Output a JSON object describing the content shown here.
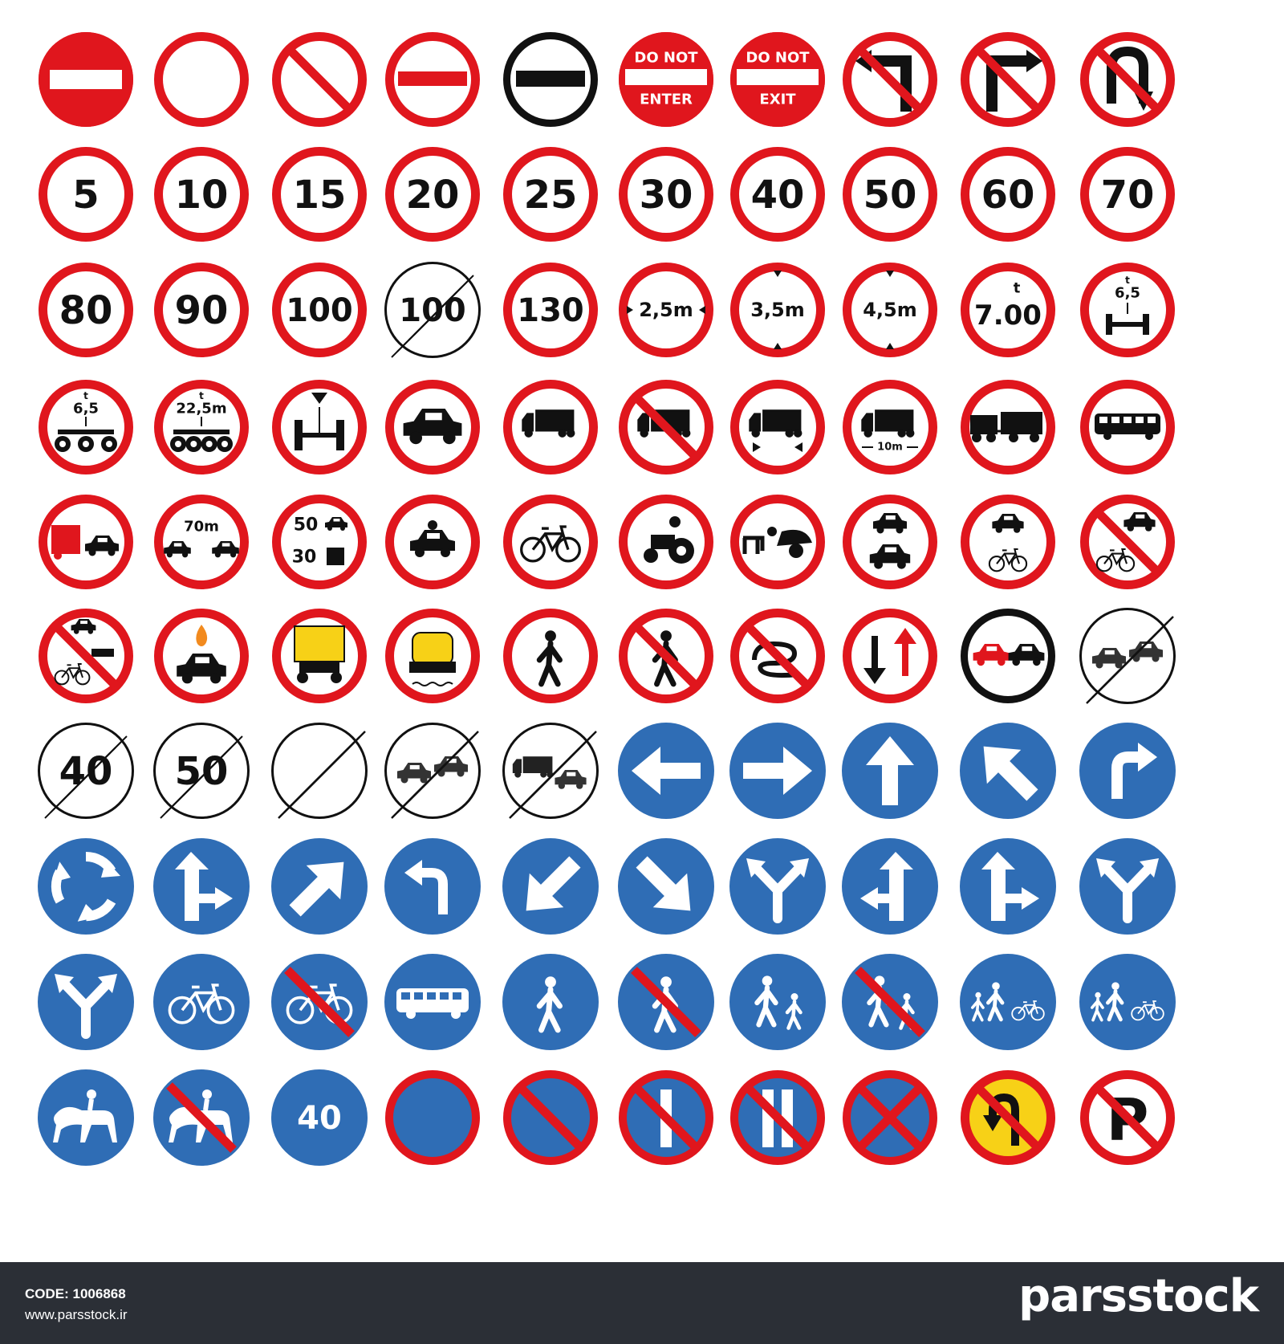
{
  "colors": {
    "red": "#e0161d",
    "blue": "#2f6db5",
    "black": "#111111",
    "white": "#ffffff",
    "yellow": "#f7d117",
    "footer": "#2b2f36"
  },
  "rows": [
    [
      {
        "kind": "red",
        "icon": "no-entry-bar-icon"
      },
      {
        "kind": "red",
        "icon": "no-vehicles-icon"
      },
      {
        "kind": "red",
        "icon": "prohibition-slash-icon"
      },
      {
        "kind": "red",
        "icon": "red-bar-icon"
      },
      {
        "kind": "black",
        "icon": "black-bar-icon"
      },
      {
        "kind": "red",
        "icon": "do-not-enter-icon",
        "lines": [
          "DO NOT",
          "ENTER"
        ]
      },
      {
        "kind": "red",
        "icon": "do-not-exit-icon",
        "lines": [
          "DO NOT",
          "EXIT"
        ]
      },
      {
        "kind": "red",
        "icon": "no-left-turn-icon"
      },
      {
        "kind": "red",
        "icon": "no-right-turn-icon"
      },
      {
        "kind": "red",
        "icon": "no-u-turn-icon"
      }
    ],
    [
      {
        "kind": "red",
        "icon": "speed-limit-icon",
        "text": "5"
      },
      {
        "kind": "red",
        "icon": "speed-limit-icon",
        "text": "10"
      },
      {
        "kind": "red",
        "icon": "speed-limit-icon",
        "text": "15"
      },
      {
        "kind": "red",
        "icon": "speed-limit-icon",
        "text": "20"
      },
      {
        "kind": "red",
        "icon": "speed-limit-icon",
        "text": "25"
      },
      {
        "kind": "red",
        "icon": "speed-limit-icon",
        "text": "30"
      },
      {
        "kind": "red",
        "icon": "speed-limit-icon",
        "text": "40"
      },
      {
        "kind": "red",
        "icon": "speed-limit-icon",
        "text": "50"
      },
      {
        "kind": "red",
        "icon": "speed-limit-icon",
        "text": "60"
      },
      {
        "kind": "red",
        "icon": "speed-limit-icon",
        "text": "70"
      }
    ],
    [
      {
        "kind": "red",
        "icon": "speed-limit-icon",
        "text": "80"
      },
      {
        "kind": "red",
        "icon": "speed-limit-icon",
        "text": "90"
      },
      {
        "kind": "red",
        "icon": "speed-limit-icon",
        "text": "100"
      },
      {
        "kind": "end",
        "icon": "end-speed-limit-icon",
        "text": "100"
      },
      {
        "kind": "red",
        "icon": "speed-limit-icon",
        "text": "130"
      },
      {
        "kind": "red",
        "icon": "max-width-icon",
        "text": "2,5m"
      },
      {
        "kind": "red",
        "icon": "max-height-icon",
        "text": "3,5m"
      },
      {
        "kind": "red",
        "icon": "max-height-icon",
        "text": "4,5m"
      },
      {
        "kind": "red",
        "icon": "max-weight-icon",
        "text": "7.00",
        "sup": "t"
      },
      {
        "kind": "red",
        "icon": "axle-weight-icon",
        "text": "6,5",
        "sup": "t"
      }
    ],
    [
      {
        "kind": "red",
        "icon": "tandem-axle-weight-icon",
        "text": "6,5",
        "sup": "t"
      },
      {
        "kind": "red",
        "icon": "triple-axle-weight-icon",
        "text": "22,5m",
        "sup": "t"
      },
      {
        "kind": "red",
        "icon": "axle-icon"
      },
      {
        "kind": "red",
        "icon": "no-cars-icon"
      },
      {
        "kind": "red",
        "icon": "no-trucks-icon"
      },
      {
        "kind": "red",
        "icon": "truck-slash-icon",
        "slash": true
      },
      {
        "kind": "red",
        "icon": "truck-width-icon"
      },
      {
        "kind": "red",
        "icon": "truck-length-icon",
        "text": "10m"
      },
      {
        "kind": "red",
        "icon": "truck-trailer-icon"
      },
      {
        "kind": "red",
        "icon": "no-bus-icon"
      }
    ],
    [
      {
        "kind": "red",
        "icon": "no-overtaking-trucks-icon"
      },
      {
        "kind": "red",
        "icon": "min-distance-icon",
        "text": "70m"
      },
      {
        "kind": "red",
        "icon": "speed-by-vehicle-icon",
        "lines": [
          "50",
          "30"
        ]
      },
      {
        "kind": "red",
        "icon": "no-quad-icon"
      },
      {
        "kind": "red",
        "icon": "no-bicycles-icon"
      },
      {
        "kind": "red",
        "icon": "no-tractors-icon"
      },
      {
        "kind": "red",
        "icon": "no-carts-icon"
      },
      {
        "kind": "red",
        "icon": "no-motor-vehicles-icon"
      },
      {
        "kind": "red",
        "icon": "no-motorcycles-bicycles-icon"
      },
      {
        "kind": "red",
        "icon": "car-bicycle-slash-icon",
        "slash": true
      }
    ],
    [
      {
        "kind": "red",
        "icon": "mixed-slash-icon",
        "slash": true
      },
      {
        "kind": "red",
        "icon": "no-dangerous-goods-icon"
      },
      {
        "kind": "red",
        "icon": "no-hazardous-load-icon"
      },
      {
        "kind": "red",
        "icon": "no-water-pollutants-icon"
      },
      {
        "kind": "red",
        "icon": "no-pedestrians-icon"
      },
      {
        "kind": "red",
        "icon": "pedestrian-slash-icon",
        "slash": true
      },
      {
        "kind": "red",
        "icon": "no-winding-slash-icon",
        "slash": true
      },
      {
        "kind": "red",
        "icon": "priority-oncoming-icon"
      },
      {
        "kind": "black",
        "icon": "no-overtaking-icon"
      },
      {
        "kind": "end",
        "icon": "end-no-overtaking-icon"
      }
    ],
    [
      {
        "kind": "end",
        "icon": "end-speed-limit-icon",
        "text": "40"
      },
      {
        "kind": "end",
        "icon": "end-speed-limit-icon",
        "text": "50"
      },
      {
        "kind": "end",
        "icon": "end-all-restrictions-icon"
      },
      {
        "kind": "end",
        "icon": "end-no-overtaking-icon"
      },
      {
        "kind": "end",
        "icon": "end-no-overtaking-trucks-icon"
      },
      {
        "kind": "blue",
        "icon": "arrow-left-icon",
        "arrow": 270
      },
      {
        "kind": "blue",
        "icon": "arrow-right-icon",
        "arrow": 90
      },
      {
        "kind": "blue",
        "icon": "arrow-up-icon",
        "arrow": 0
      },
      {
        "kind": "blue",
        "icon": "arrow-up-left-icon",
        "arrow": 315
      },
      {
        "kind": "blue",
        "icon": "turn-right-icon"
      }
    ],
    [
      {
        "kind": "blue",
        "icon": "roundabout-icon"
      },
      {
        "kind": "blue",
        "icon": "straight-or-right-icon"
      },
      {
        "kind": "blue",
        "icon": "arrow-up-right-icon",
        "arrow": 45
      },
      {
        "kind": "blue",
        "icon": "turn-left-icon"
      },
      {
        "kind": "blue",
        "icon": "arrow-down-left-icon",
        "arrow": 225
      },
      {
        "kind": "blue",
        "icon": "arrow-down-right-icon",
        "arrow": 135
      },
      {
        "kind": "blue",
        "icon": "pass-either-side-icon"
      },
      {
        "kind": "blue",
        "icon": "straight-or-left-icon"
      },
      {
        "kind": "blue",
        "icon": "straight-or-right-icon"
      },
      {
        "kind": "blue",
        "icon": "left-or-right-icon"
      }
    ],
    [
      {
        "kind": "blue",
        "icon": "split-arrows-icon"
      },
      {
        "kind": "blue",
        "icon": "bicycle-path-icon"
      },
      {
        "kind": "blue",
        "icon": "end-bicycle-path-icon",
        "slash": true
      },
      {
        "kind": "blue",
        "icon": "bus-lane-icon"
      },
      {
        "kind": "blue",
        "icon": "pedestrian-path-icon"
      },
      {
        "kind": "blue",
        "icon": "end-pedestrian-path-icon",
        "slash": true
      },
      {
        "kind": "blue",
        "icon": "shared-footpath-icon"
      },
      {
        "kind": "blue",
        "icon": "end-shared-footpath-icon",
        "slash": true
      },
      {
        "kind": "blue",
        "icon": "segregated-path-icon"
      },
      {
        "kind": "blue",
        "icon": "segregated-path-icon"
      }
    ],
    [
      {
        "kind": "blue",
        "icon": "bridleway-icon"
      },
      {
        "kind": "blue",
        "icon": "end-bridleway-icon",
        "slash": true
      },
      {
        "kind": "blue",
        "icon": "minimum-speed-icon",
        "text": "40"
      },
      {
        "kind": "noparking",
        "icon": "no-waiting-icon"
      },
      {
        "kind": "noparking",
        "icon": "no-parking-icon",
        "slash": true
      },
      {
        "kind": "noparking",
        "icon": "no-parking-odd-days-icon",
        "slash": true,
        "bars": 1
      },
      {
        "kind": "noparking",
        "icon": "no-parking-even-days-icon",
        "slash": true,
        "bars": 2
      },
      {
        "kind": "noparking",
        "icon": "no-stopping-icon",
        "cross": true
      },
      {
        "kind": "yellow",
        "icon": "no-u-turn-yellow-icon",
        "slash": true
      },
      {
        "kind": "red",
        "icon": "no-parking-p-icon",
        "text": "P",
        "slash": true
      }
    ]
  ],
  "footer": {
    "code": "CODE: 1006868",
    "site": "www.parsstock.ir",
    "brand": "parsstock"
  }
}
